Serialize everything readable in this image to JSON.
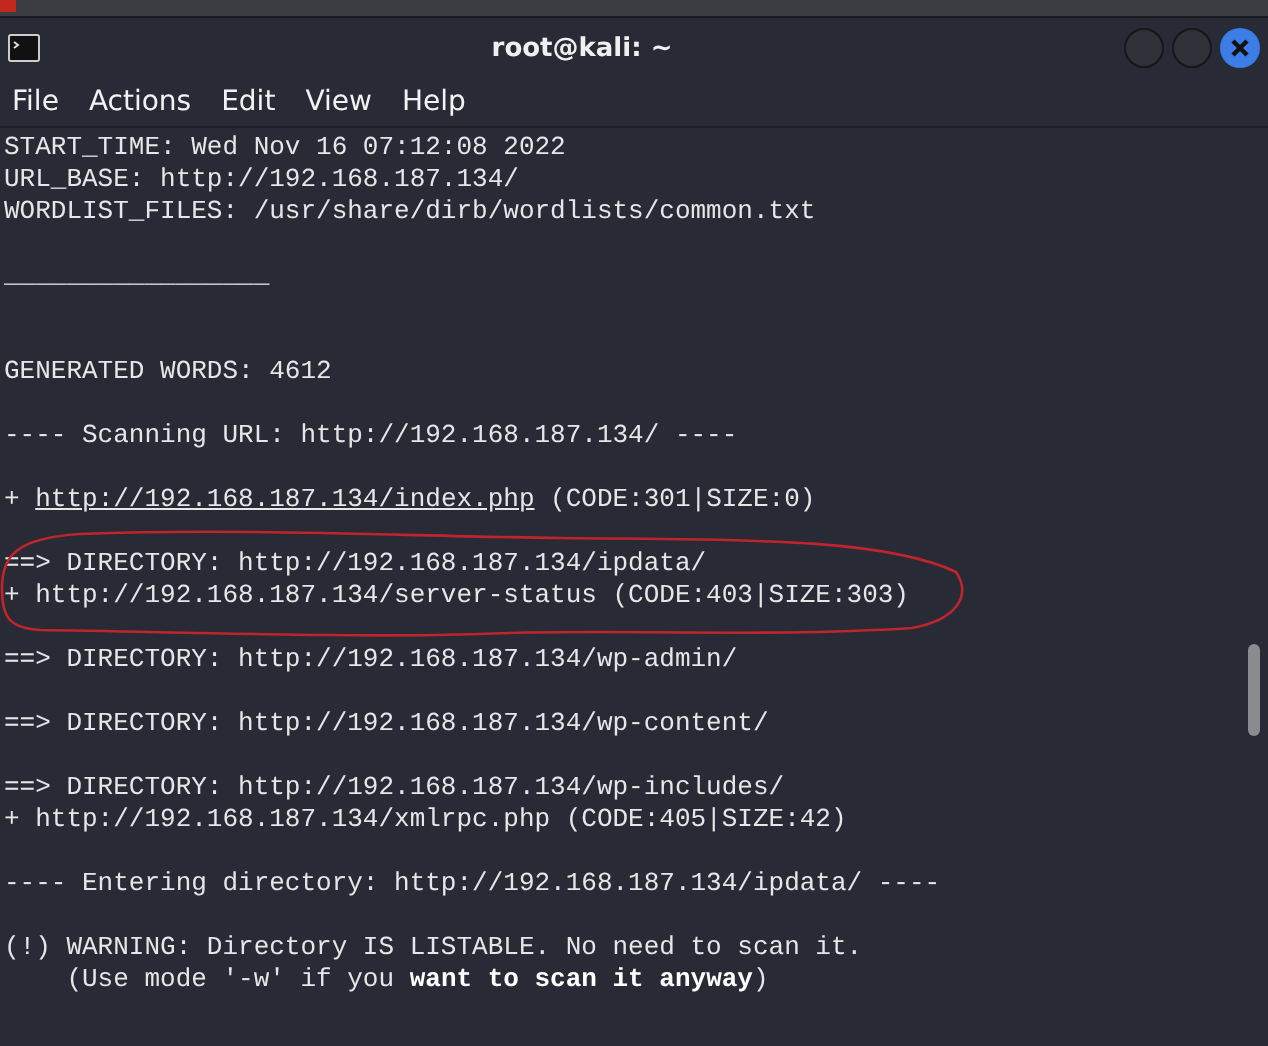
{
  "window": {
    "title": "root@kali: ~"
  },
  "menu": [
    "File",
    "Actions",
    "Edit",
    "View",
    "Help"
  ],
  "terminal": {
    "lines": [
      {
        "kind": "text",
        "text": "START_TIME: Wed Nov 16 07:12:08 2022"
      },
      {
        "kind": "text",
        "text": "URL_BASE: http://192.168.187.134/"
      },
      {
        "kind": "text",
        "text": "WORDLIST_FILES: /usr/share/dirb/wordlists/common.txt"
      },
      {
        "kind": "blank"
      },
      {
        "kind": "text",
        "text": "_________________"
      },
      {
        "kind": "blank"
      },
      {
        "kind": "blank"
      },
      {
        "kind": "text",
        "text": "GENERATED WORDS: 4612"
      },
      {
        "kind": "blank"
      },
      {
        "kind": "text",
        "text": "---- Scanning URL: http://192.168.187.134/ ----"
      },
      {
        "kind": "blank"
      },
      {
        "kind": "link",
        "prefix": "+ ",
        "link": "http://192.168.187.134/index.php",
        "suffix": " (CODE:301|SIZE:0)"
      },
      {
        "kind": "blank"
      },
      {
        "kind": "text",
        "text": "==> DIRECTORY: http://192.168.187.134/ipdata/"
      },
      {
        "kind": "text",
        "text": "+ http://192.168.187.134/server-status (CODE:403|SIZE:303)"
      },
      {
        "kind": "blank"
      },
      {
        "kind": "text",
        "text": "==> DIRECTORY: http://192.168.187.134/wp-admin/"
      },
      {
        "kind": "blank"
      },
      {
        "kind": "text",
        "text": "==> DIRECTORY: http://192.168.187.134/wp-content/"
      },
      {
        "kind": "blank"
      },
      {
        "kind": "text",
        "text": "==> DIRECTORY: http://192.168.187.134/wp-includes/"
      },
      {
        "kind": "text",
        "text": "+ http://192.168.187.134/xmlrpc.php (CODE:405|SIZE:42)"
      },
      {
        "kind": "blank"
      },
      {
        "kind": "text",
        "text": "---- Entering directory: http://192.168.187.134/ipdata/ ----"
      },
      {
        "kind": "blank"
      },
      {
        "kind": "text",
        "text": "(!) WARNING: Directory IS LISTABLE. No need to scan it."
      },
      {
        "kind": "text",
        "text": "    (Use mode '-w' if you **want to scan it anyway**)"
      }
    ]
  }
}
